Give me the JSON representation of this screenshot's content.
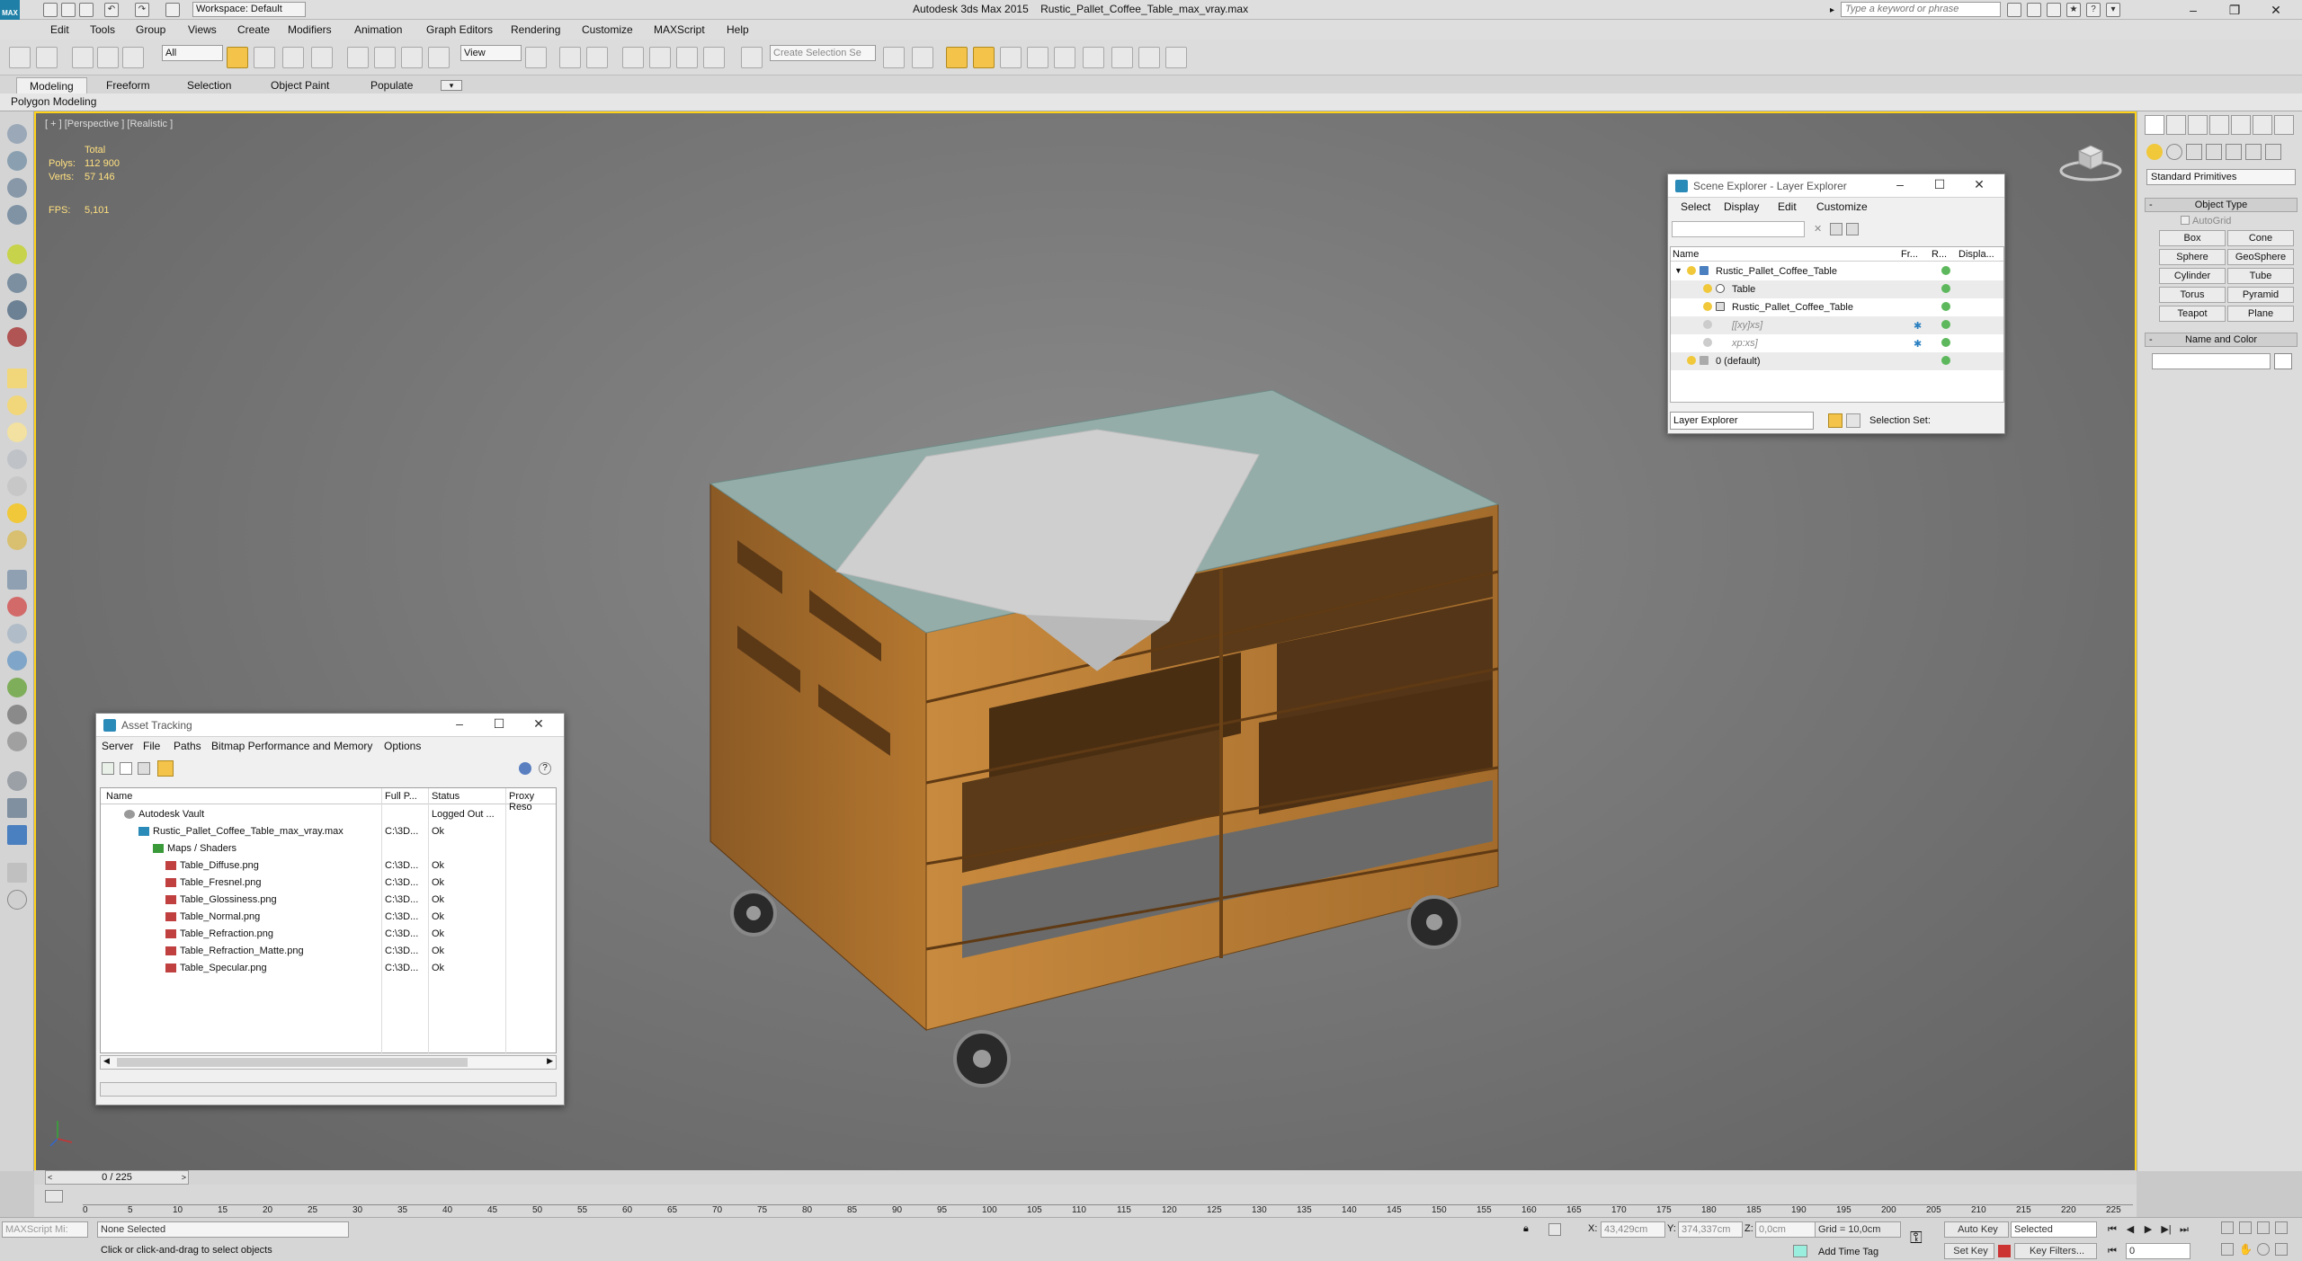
{
  "titlebar": {
    "app": "Autodesk 3ds Max  2015",
    "file": "Rustic_Pallet_Coffee_Table_max_vray.max",
    "workspace": "Workspace: Default",
    "search_placeholder": "Type a keyword or phrase",
    "logo": "MAX"
  },
  "menu": [
    "Edit",
    "Tools",
    "Group",
    "Views",
    "Create",
    "Modifiers",
    "Animation",
    "Graph Editors",
    "Rendering",
    "Customize",
    "MAXScript",
    "Help"
  ],
  "toolbar": {
    "selection_filter": "All",
    "ref_coord": "View",
    "named_selection": "Create Selection Se"
  },
  "ribbon": {
    "tabs": [
      "Modeling",
      "Freeform",
      "Selection",
      "Object Paint",
      "Populate"
    ],
    "panel": "Polygon Modeling"
  },
  "viewport": {
    "label": "[ + ] [Perspective ] [Realistic ]",
    "stats_header": "Total",
    "polys_label": "Polys:",
    "polys": "112 900",
    "verts_label": "Verts:",
    "verts": "57 146",
    "fps_label": "FPS:",
    "fps": "5,101"
  },
  "command_panel": {
    "dropdown": "Standard Primitives",
    "object_type": "Object Type",
    "autogrid": "AutoGrid",
    "buttons": [
      "Box",
      "Cone",
      "Sphere",
      "GeoSphere",
      "Cylinder",
      "Tube",
      "Torus",
      "Pyramid",
      "Teapot",
      "Plane"
    ],
    "name_and_color": "Name and Color"
  },
  "asset_tracking": {
    "title": "Asset Tracking",
    "menu": [
      "Server",
      "File",
      "Paths",
      "Bitmap Performance and Memory",
      "Options"
    ],
    "columns": [
      "Name",
      "Full P...",
      "Status",
      "Proxy Reso"
    ],
    "rows": [
      {
        "name": "Autodesk Vault",
        "path": "",
        "status": "Logged Out ..."
      },
      {
        "name": "Rustic_Pallet_Coffee_Table_max_vray.max",
        "path": "C:\\3D...",
        "status": "Ok"
      },
      {
        "name": "Maps / Shaders",
        "path": "",
        "status": ""
      },
      {
        "name": "Table_Diffuse.png",
        "path": "C:\\3D...",
        "status": "Ok"
      },
      {
        "name": "Table_Fresnel.png",
        "path": "C:\\3D...",
        "status": "Ok"
      },
      {
        "name": "Table_Glossiness.png",
        "path": "C:\\3D...",
        "status": "Ok"
      },
      {
        "name": "Table_Normal.png",
        "path": "C:\\3D...",
        "status": "Ok"
      },
      {
        "name": "Table_Refraction.png",
        "path": "C:\\3D...",
        "status": "Ok"
      },
      {
        "name": "Table_Refraction_Matte.png",
        "path": "C:\\3D...",
        "status": "Ok"
      },
      {
        "name": "Table_Specular.png",
        "path": "C:\\3D...",
        "status": "Ok"
      }
    ]
  },
  "scene_explorer": {
    "title": "Scene Explorer - Layer Explorer",
    "menu": [
      "Select",
      "Display",
      "Edit",
      "Customize"
    ],
    "columns": [
      "Name",
      "Fr...",
      "R...",
      "Displa..."
    ],
    "rows": [
      "Rustic_Pallet_Coffee_Table",
      "Table",
      "Rustic_Pallet_Coffee_Table",
      "[[xy]xs]",
      "xp:xs]",
      "0 (default)"
    ],
    "footer_dropdown": "Layer Explorer",
    "selection_set_label": "Selection Set:"
  },
  "timeline": {
    "slider": "0 / 225",
    "ticks": [
      "0",
      "5",
      "10",
      "15",
      "20",
      "25",
      "30",
      "35",
      "40",
      "45",
      "50",
      "55",
      "60",
      "65",
      "70",
      "75",
      "80",
      "85",
      "90",
      "95",
      "100",
      "105",
      "110",
      "115",
      "120",
      "125",
      "130",
      "135",
      "140",
      "145",
      "150",
      "155",
      "160",
      "165",
      "170",
      "175",
      "180",
      "185",
      "190",
      "195",
      "200",
      "205",
      "210",
      "215",
      "220",
      "225"
    ]
  },
  "status": {
    "maxscript": "MAXScript Mi:",
    "selected_text": "None Selected",
    "prompt": "Click or click-and-drag to select objects",
    "x_label": "X:",
    "x": "43,429cm",
    "y_label": "Y:",
    "y": "374,337cm",
    "z_label": "Z:",
    "z": "0,0cm",
    "grid": "Grid = 10,0cm",
    "add_time_tag": "Add Time Tag",
    "auto_key": "Auto Key",
    "set_key": "Set Key",
    "selected_drop": "Selected",
    "key_filters": "Key Filters...",
    "frame": "0"
  },
  "colors": {
    "viewport_border": "#ffd21a",
    "active_tool": "#f3c34a",
    "stats_text": "#ffe080",
    "viewport_bg": "#767676"
  }
}
